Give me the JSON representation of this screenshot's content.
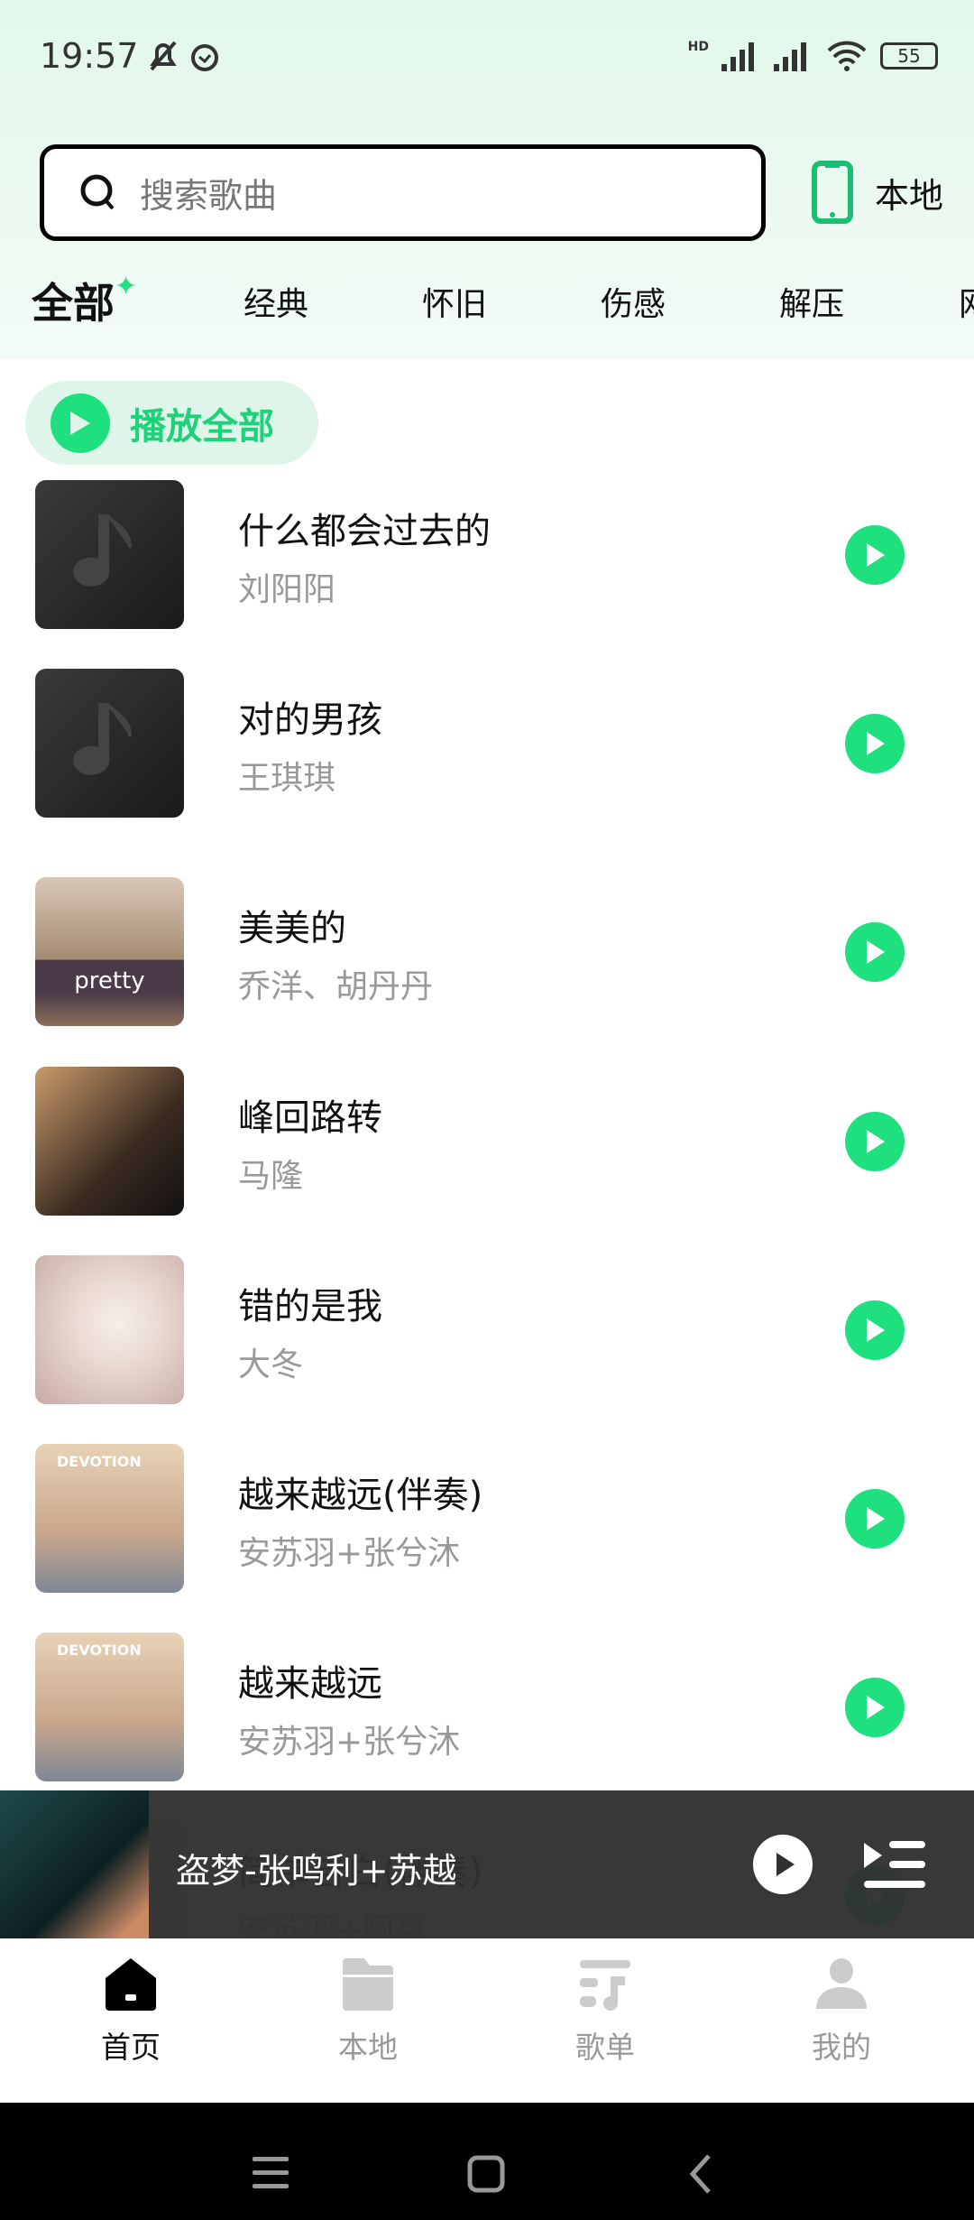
{
  "status_bar": {
    "time": "19:57",
    "battery": "55",
    "network": "HD"
  },
  "search": {
    "placeholder": "搜索歌曲"
  },
  "local_button": {
    "label": "本地"
  },
  "tabs": [
    {
      "label": "全部",
      "active": true
    },
    {
      "label": "经典"
    },
    {
      "label": "怀旧"
    },
    {
      "label": "伤感"
    },
    {
      "label": "解压"
    },
    {
      "label": "网"
    }
  ],
  "play_all": {
    "label": "播放全部"
  },
  "songs": [
    {
      "title": "什么都会过去的",
      "artist": "刘阳阳",
      "art": "music-note-placeholder"
    },
    {
      "title": "对的男孩",
      "artist": "王琪琪",
      "art": "music-note-placeholder"
    },
    {
      "title": "美美的",
      "artist": "乔洋、胡丹丹",
      "art": "pretty"
    },
    {
      "title": "峰回路转",
      "artist": "马隆",
      "art": "马隆"
    },
    {
      "title": "错的是我",
      "artist": "大冬",
      "art": "portrait"
    },
    {
      "title": "越来越远(伴奏)",
      "artist": "安苏羽+张兮沐",
      "art": "DEVOTION"
    },
    {
      "title": "越来越远",
      "artist": "安苏羽+张兮沐",
      "art": "DEVOTION"
    },
    {
      "title": "简单告白(伴奏)",
      "artist": "安苏羽+阿夏",
      "art": "portrait"
    }
  ],
  "player": {
    "now_playing": "盗梦-张鸣利+苏越"
  },
  "nav": [
    {
      "label": "首页",
      "icon": "home-icon",
      "active": true
    },
    {
      "label": "本地",
      "icon": "folder-icon"
    },
    {
      "label": "歌单",
      "icon": "playlist-icon"
    },
    {
      "label": "我的",
      "icon": "user-icon"
    }
  ],
  "colors": {
    "accent": "#1ee07f",
    "header_bg": "#e2f7ea",
    "player_bg": "#303030"
  }
}
